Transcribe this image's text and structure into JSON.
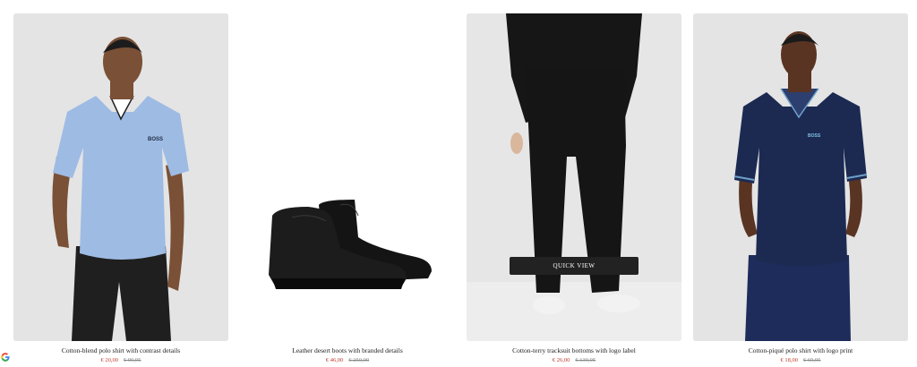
{
  "products": [
    {
      "name": "Cotton-blend polo shirt with contrast details",
      "price": "€ 20,00",
      "old_price": "€ 99,95"
    },
    {
      "name": "Leather desert boots with branded details",
      "price": "€ 46,00",
      "old_price": "€ 250,00"
    },
    {
      "name": "Cotton-terry tracksuit bottoms with logo label",
      "price": "€ 26,00",
      "old_price": "€ 139,95"
    },
    {
      "name": "Cotton-piqué polo shirt with logo print",
      "price": "€ 18,00",
      "old_price": "€ 69,95"
    }
  ],
  "quick_view_label": "QUICK VIEW",
  "logos": {
    "polo1": "BOSS",
    "polo2": "BOSS"
  },
  "icons": {
    "corner": "google-g-icon"
  },
  "colors": {
    "price": "#c0392b",
    "quick_view_bg": "#222222",
    "card_bg": "#e6e6e6"
  }
}
